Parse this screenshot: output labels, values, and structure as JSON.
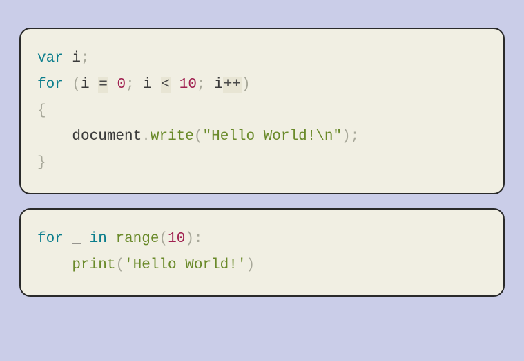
{
  "block1": {
    "l1_var": "var",
    "l1_i": "i",
    "l1_semi": ";",
    "l2_for": "for",
    "l2_lp": "(",
    "l2_i1": "i",
    "l2_eq": "=",
    "l2_zero": "0",
    "l2_semi1": ";",
    "l2_i2": "i",
    "l2_lt": "<",
    "l2_ten": "10",
    "l2_semi2": ";",
    "l2_i3": "i",
    "l2_pp": "++",
    "l2_rp": ")",
    "l3_lbrace": "{",
    "l4_indent": "    ",
    "l4_doc": "document",
    "l4_dot": ".",
    "l4_write": "write",
    "l4_lp": "(",
    "l4_str": "\"Hello World!\\n\"",
    "l4_rp": ")",
    "l4_semi": ";",
    "l5_rbrace": "}"
  },
  "block2": {
    "l1_for": "for",
    "l1_us": "_",
    "l1_in": "in",
    "l1_range": "range",
    "l1_lp": "(",
    "l1_ten": "10",
    "l1_rp": ")",
    "l1_colon": ":",
    "l2_indent": "    ",
    "l2_print": "print",
    "l2_lp": "(",
    "l2_str": "'Hello World!'",
    "l2_rp": ")"
  }
}
